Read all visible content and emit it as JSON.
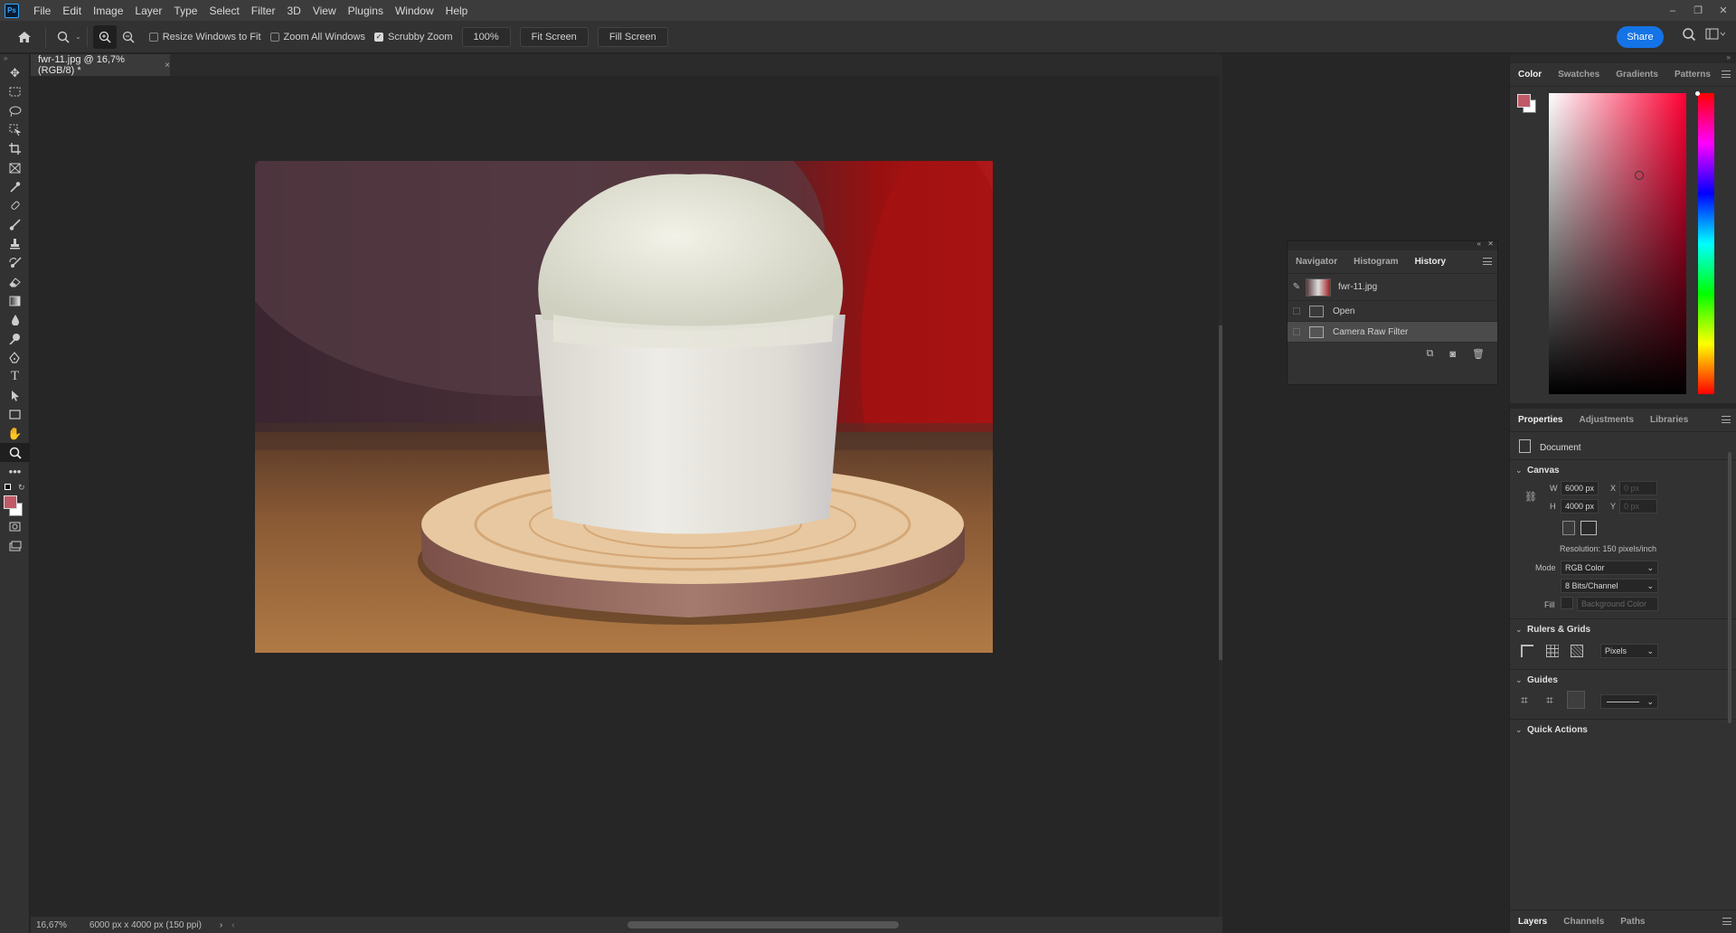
{
  "app": {
    "logo": "Ps"
  },
  "menu": [
    "File",
    "Edit",
    "Image",
    "Layer",
    "Type",
    "Select",
    "Filter",
    "3D",
    "View",
    "Plugins",
    "Window",
    "Help"
  ],
  "window_controls": {
    "minimize": "–",
    "restore": "❐",
    "close": "✕"
  },
  "options_bar": {
    "resize_windows": "Resize Windows to Fit",
    "zoom_all": "Zoom All Windows",
    "scrubby_zoom": "Scrubby Zoom",
    "zoom_value": "100%",
    "fit_screen": "Fit Screen",
    "fill_screen": "Fill Screen",
    "share": "Share",
    "resize_checked": false,
    "zoom_all_checked": false,
    "scrubby_checked": true
  },
  "document_tab": {
    "title": "fwr-11.jpg @ 16,7% (RGB/8) *",
    "close": "×"
  },
  "status_bar": {
    "zoom": "16,67%",
    "doc_info": "6000 px x 4000 px (150 ppi)",
    "arrow": "›",
    "left_arrow": "‹"
  },
  "history_panel": {
    "tabs": [
      "Navigator",
      "Histogram",
      "History"
    ],
    "active_tab": "History",
    "snapshot_name": "fwr-11.jpg",
    "steps": [
      "Open",
      "Camera Raw Filter"
    ],
    "selected_step": "Camera Raw Filter"
  },
  "color_panel": {
    "tabs": [
      "Color",
      "Swatches",
      "Gradients",
      "Patterns"
    ],
    "active_tab": "Color",
    "foreground": "#c05a66",
    "background": "#ffffff",
    "hue_base": "#ff0033"
  },
  "properties_panel": {
    "tabs": [
      "Properties",
      "Adjustments",
      "Libraries"
    ],
    "active_tab": "Properties",
    "doc_label": "Document",
    "canvas_title": "Canvas",
    "w_label": "W",
    "w_value": "6000 px",
    "h_label": "H",
    "h_value": "4000 px",
    "x_label": "X",
    "x_value": "0 px",
    "y_label": "Y",
    "y_value": "0 px",
    "resolution": "Resolution: 150 pixels/inch",
    "mode_label": "Mode",
    "mode_value": "RGB Color",
    "bits_value": "8 Bits/Channel",
    "fill_label": "Fill",
    "fill_value": "Background Color",
    "rulers_title": "Rulers & Grids",
    "units_value": "Pixels",
    "guides_title": "Guides",
    "quick_actions_title": "Quick Actions"
  },
  "bottom_tabs": [
    "Layers",
    "Channels",
    "Paths"
  ],
  "bottom_active": "Layers"
}
